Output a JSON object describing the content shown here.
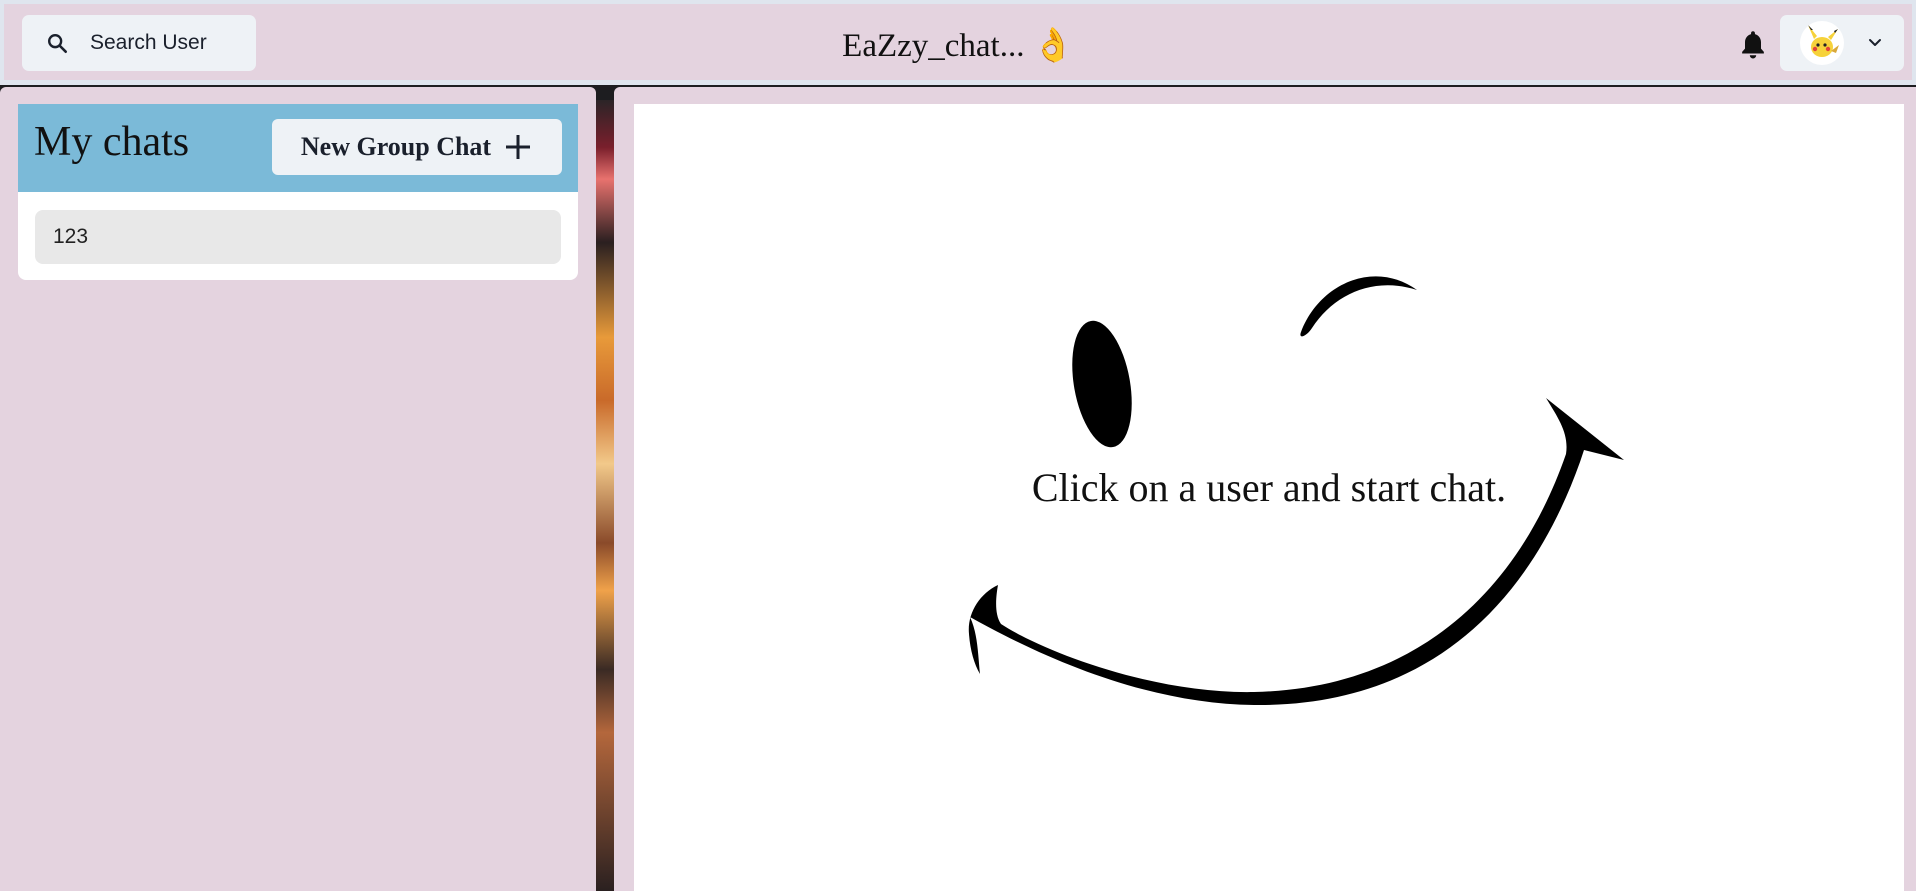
{
  "header": {
    "search_label": "Search User",
    "app_title": "EaZzy_chat... 👌"
  },
  "sidebar": {
    "title": "My chats",
    "new_group_label": "New Group Chat",
    "chats": [
      {
        "name": "123"
      }
    ]
  },
  "main": {
    "empty_message": "Click on a user and start chat."
  },
  "colors": {
    "header_bg": "#e4d3df",
    "chats_header_bg": "#7bbad8",
    "button_bg": "#eef2f6",
    "chat_item_bg": "#e8e8e8"
  },
  "icons": [
    "search-icon",
    "bell-icon",
    "avatar",
    "chevron-down-icon",
    "plus-icon",
    "smiley-illustration"
  ]
}
